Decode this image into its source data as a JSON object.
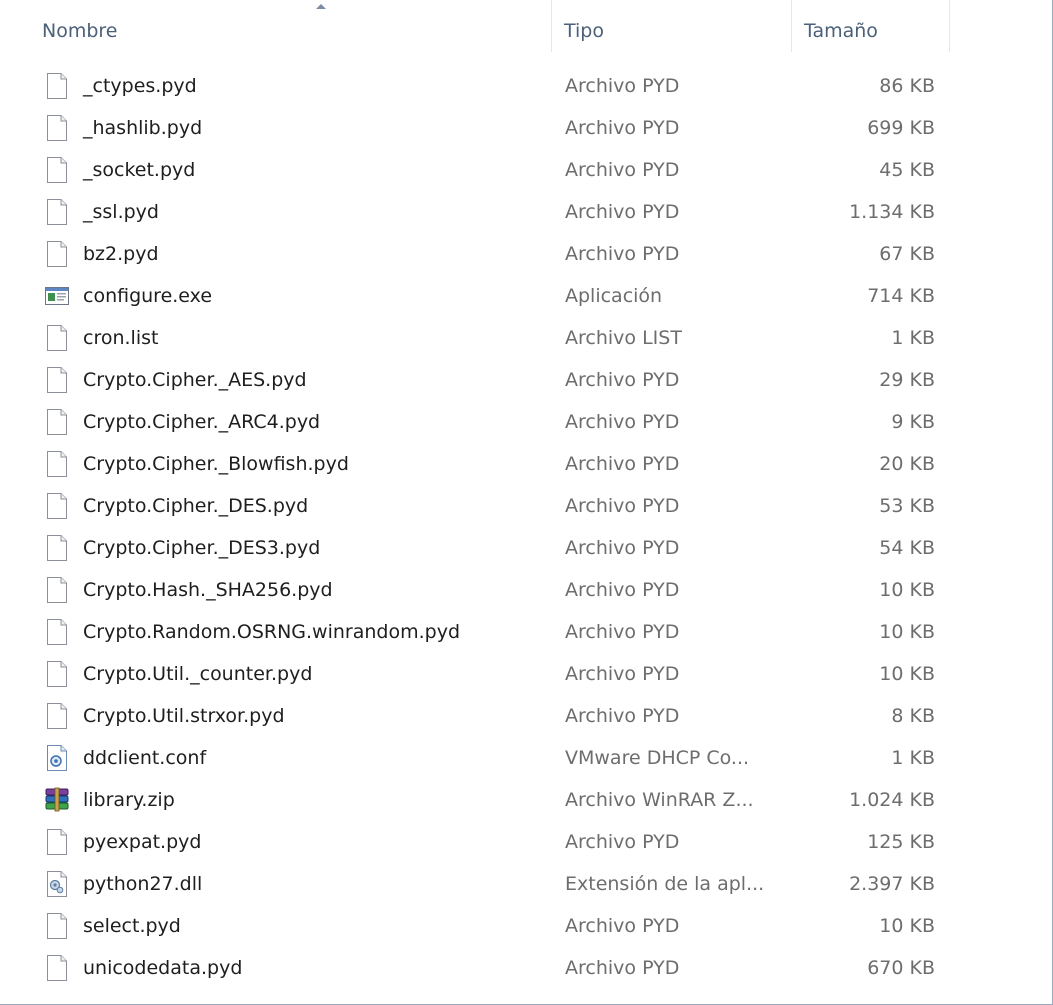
{
  "columns": {
    "name": "Nombre",
    "type": "Tipo",
    "size": "Tamaño"
  },
  "files": [
    {
      "name": "_ctypes.pyd",
      "type": "Archivo PYD",
      "size": "86 KB",
      "icon": "file-icon"
    },
    {
      "name": "_hashlib.pyd",
      "type": "Archivo PYD",
      "size": "699 KB",
      "icon": "file-icon"
    },
    {
      "name": "_socket.pyd",
      "type": "Archivo PYD",
      "size": "45 KB",
      "icon": "file-icon"
    },
    {
      "name": "_ssl.pyd",
      "type": "Archivo PYD",
      "size": "1.134 KB",
      "icon": "file-icon"
    },
    {
      "name": "bz2.pyd",
      "type": "Archivo PYD",
      "size": "67 KB",
      "icon": "file-icon"
    },
    {
      "name": "configure.exe",
      "type": "Aplicación",
      "size": "714 KB",
      "icon": "application-icon"
    },
    {
      "name": "cron.list",
      "type": "Archivo LIST",
      "size": "1 KB",
      "icon": "file-icon"
    },
    {
      "name": "Crypto.Cipher._AES.pyd",
      "type": "Archivo PYD",
      "size": "29 KB",
      "icon": "file-icon"
    },
    {
      "name": "Crypto.Cipher._ARC4.pyd",
      "type": "Archivo PYD",
      "size": "9 KB",
      "icon": "file-icon"
    },
    {
      "name": "Crypto.Cipher._Blowfish.pyd",
      "type": "Archivo PYD",
      "size": "20 KB",
      "icon": "file-icon"
    },
    {
      "name": "Crypto.Cipher._DES.pyd",
      "type": "Archivo PYD",
      "size": "53 KB",
      "icon": "file-icon"
    },
    {
      "name": "Crypto.Cipher._DES3.pyd",
      "type": "Archivo PYD",
      "size": "54 KB",
      "icon": "file-icon"
    },
    {
      "name": "Crypto.Hash._SHA256.pyd",
      "type": "Archivo PYD",
      "size": "10 KB",
      "icon": "file-icon"
    },
    {
      "name": "Crypto.Random.OSRNG.winrandom.pyd",
      "type": "Archivo PYD",
      "size": "10 KB",
      "icon": "file-icon"
    },
    {
      "name": "Crypto.Util._counter.pyd",
      "type": "Archivo PYD",
      "size": "10 KB",
      "icon": "file-icon"
    },
    {
      "name": "Crypto.Util.strxor.pyd",
      "type": "Archivo PYD",
      "size": "8 KB",
      "icon": "file-icon"
    },
    {
      "name": "ddclient.conf",
      "type": "VMware DHCP Co...",
      "size": "1 KB",
      "icon": "config-file-icon"
    },
    {
      "name": "library.zip",
      "type": "Archivo WinRAR Z...",
      "size": "1.024 KB",
      "icon": "winrar-archive-icon"
    },
    {
      "name": "pyexpat.pyd",
      "type": "Archivo PYD",
      "size": "125 KB",
      "icon": "file-icon"
    },
    {
      "name": "python27.dll",
      "type": "Extensión de la apl...",
      "size": "2.397 KB",
      "icon": "dll-file-icon"
    },
    {
      "name": "select.pyd",
      "type": "Archivo PYD",
      "size": "10 KB",
      "icon": "file-icon"
    },
    {
      "name": "unicodedata.pyd",
      "type": "Archivo PYD",
      "size": "670 KB",
      "icon": "file-icon"
    }
  ]
}
